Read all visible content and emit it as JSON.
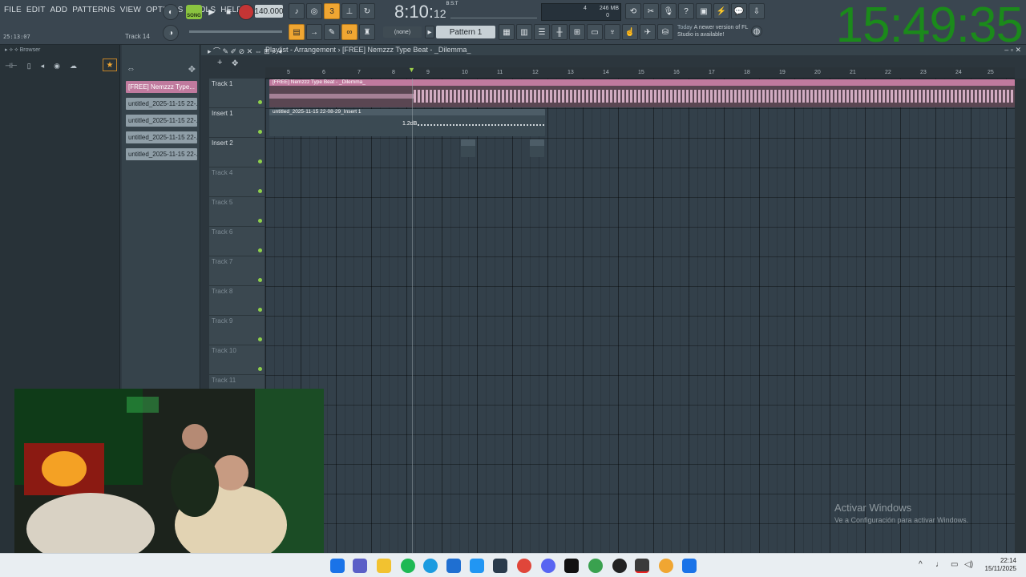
{
  "menu": [
    "FILE",
    "EDIT",
    "ADD",
    "PATTERNS",
    "VIEW",
    "OPTIONS",
    "TOOLS",
    "HELP"
  ],
  "transport": {
    "mode_label": "SONG",
    "tempo": "140.000",
    "time_main": "8:10",
    "time_ticks": "12",
    "time_sup": "B:S:T",
    "cpu_value": "4",
    "ram_value": "246 MB",
    "poly_value": "0",
    "elapsed": "25:13:07",
    "hint_target": "Track 14"
  },
  "toolbar": {
    "pattern_selector": "Pattern 1",
    "none_selector": "(none)",
    "news_day": "Today",
    "news_text": "A newer version of FL Studio is available!"
  },
  "overlay_clock": "15:49:35",
  "browser": {
    "title": "Browser"
  },
  "picker": {
    "items": [
      "[FREE] Nemzzz Type...",
      "untitled_2025-11-15 22-...",
      "untitled_2025-11-15 22-...",
      "untitled_2025-11-15 22-...",
      "untitled_2025-11-15 22-..."
    ]
  },
  "playlist": {
    "title": "Playlist - Arrangement",
    "breadcrumb": "[FREE] Nemzzz Type Beat - _Dilemma_",
    "ruler": [
      "5",
      "6",
      "7",
      "8",
      "9",
      "10",
      "11",
      "12",
      "13",
      "14",
      "15",
      "16",
      "17",
      "18",
      "19",
      "20",
      "21",
      "22",
      "23",
      "24",
      "25"
    ],
    "tracks": [
      "Track 1",
      "Insert 1",
      "Insert 2",
      "Track 4",
      "Track 5",
      "Track 6",
      "Track 7",
      "Track 8",
      "Track 9",
      "Track 10",
      "Track 11"
    ],
    "clips": [
      {
        "label": "[FREE] Nemzzz Type Beat - _Dilemma_",
        "color": "#c07a9e"
      },
      {
        "label": "untitled_2025-11-15 22-08-29_Insert 1",
        "color": "#3b4a53",
        "gain": "1.2dB"
      },
      {
        "label": "",
        "color": "#3b4a53"
      },
      {
        "label": "",
        "color": "#3b4a53"
      }
    ]
  },
  "watermark": {
    "title": "Activar Windows",
    "subtitle": "Ve a Configuración para activar Windows."
  },
  "taskbar": {
    "time": "22:14",
    "date": "15/11/2025"
  }
}
